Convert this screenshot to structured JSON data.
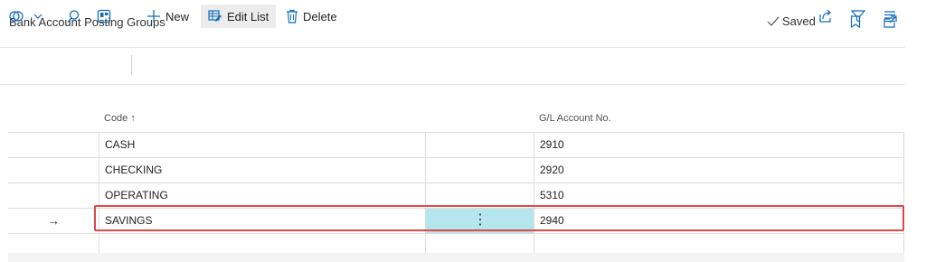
{
  "header": {
    "title": "Bank Account Posting Groups",
    "saved_label": "Saved"
  },
  "toolbar": {
    "new_label": "New",
    "edit_list_label": "Edit List",
    "delete_label": "Delete"
  },
  "table": {
    "columns": [
      "Code",
      "G/L Account No."
    ],
    "sort_indicator": "↑",
    "rows": [
      {
        "code": "CASH",
        "gl_account": "2910"
      },
      {
        "code": "CHECKING",
        "gl_account": "2920"
      },
      {
        "code": "OPERATING",
        "gl_account": "5310"
      },
      {
        "code": "SAVINGS",
        "gl_account": "2940"
      }
    ],
    "selected_row_marker": "→",
    "row_menu_glyph": "⋮"
  },
  "colors": {
    "accent": "#0f6cbd",
    "selected_cell": "#b4e6ee",
    "highlight_border": "#e04848"
  }
}
